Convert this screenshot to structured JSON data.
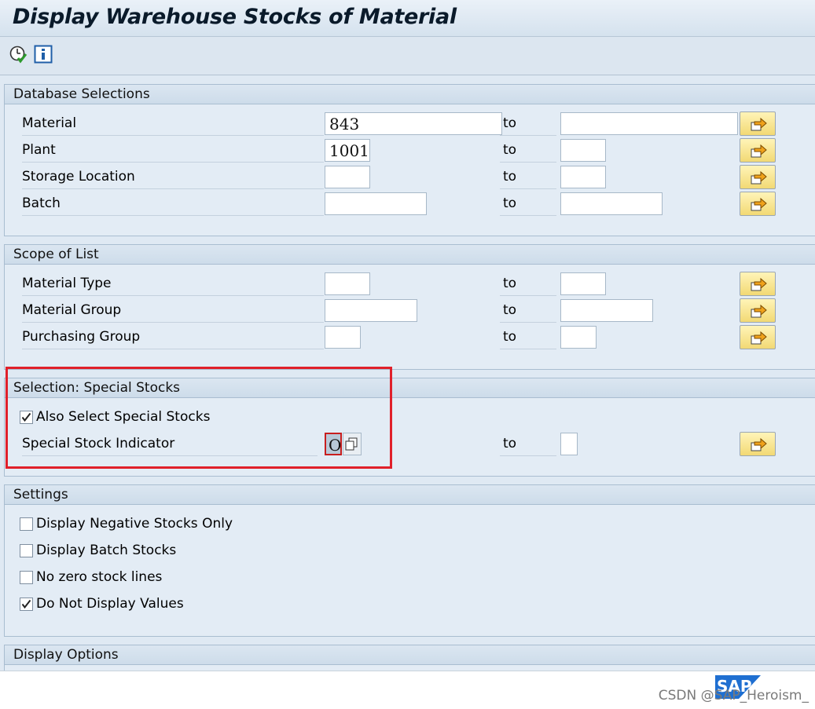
{
  "window": {
    "title": "Display Warehouse Stocks of Material"
  },
  "toolbar": {
    "execute_icon": "execute-clock-icon",
    "info_icon": "info-icon"
  },
  "common": {
    "to": "to"
  },
  "groups": {
    "database": {
      "title": "Database Selections",
      "rows": [
        {
          "label": "Material",
          "from": "843",
          "to": ""
        },
        {
          "label": "Plant",
          "from": "1001",
          "to": ""
        },
        {
          "label": "Storage Location",
          "from": "",
          "to": ""
        },
        {
          "label": "Batch",
          "from": "",
          "to": ""
        }
      ]
    },
    "scope": {
      "title": "Scope of List",
      "rows": [
        {
          "label": "Material Type",
          "from": "",
          "to": ""
        },
        {
          "label": "Material Group",
          "from": "",
          "to": ""
        },
        {
          "label": "Purchasing Group",
          "from": "",
          "to": ""
        }
      ]
    },
    "special": {
      "title": "Selection: Special Stocks",
      "checkbox": {
        "label": "Also Select Special Stocks",
        "checked": true
      },
      "indicator": {
        "label": "Special Stock Indicator",
        "from": "O",
        "to": ""
      }
    },
    "settings": {
      "title": "Settings",
      "checkboxes": [
        {
          "label": "Display Negative Stocks Only",
          "checked": false
        },
        {
          "label": "Display Batch Stocks",
          "checked": false
        },
        {
          "label": "No zero stock lines",
          "checked": false
        },
        {
          "label": "Do Not Display Values",
          "checked": true
        }
      ]
    },
    "display": {
      "title": "Display Options"
    }
  },
  "footer": {
    "logo": "SAP",
    "watermark": "CSDN @SAP_Heroism_"
  }
}
